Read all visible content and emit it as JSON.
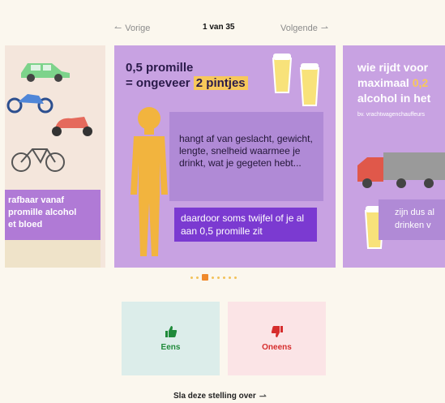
{
  "nav": {
    "prev_label": "Vorige",
    "counter": "1 van 35",
    "next_label": "Volgende"
  },
  "cards": {
    "left": {
      "text_lines": [
        "rafbaar vanaf",
        "promille alcohol",
        "et bloed"
      ]
    },
    "main": {
      "title_line1": "0,5 promille",
      "title_line2_prefix": "= ongeveer ",
      "title_highlight": "2 pintjes",
      "speech_text": "hangt af van geslacht, gewicht, lengte, snelheid waarmee je drinkt, wat je gegeten hebt...",
      "box_text": "daardoor soms twijfel of je al aan 0,5 promille zit"
    },
    "right": {
      "title_line1": "wie rijdt voor",
      "title_line2_prefix": "maximaal ",
      "title_line2_highlight": "0,2",
      "title_line3": "alcohol in het",
      "subtitle": "bv. vrachtwagenchauffeurs",
      "bubble_line1": "zijn dus al",
      "bubble_line2": "drinken v"
    }
  },
  "pagination": {
    "total_visible_dots": 9,
    "active_index": 2
  },
  "vote": {
    "agree_label": "Eens",
    "disagree_label": "Oneens"
  },
  "skip_label": "Sla deze stelling over",
  "colors": {
    "background": "#fbf7ee",
    "card_purple": "#c8a2e2",
    "accent_purple": "#7b3ad1",
    "highlight_yellow": "#f7c85a",
    "agree_green": "#1f8a3a",
    "disagree_red": "#d62d2d"
  }
}
